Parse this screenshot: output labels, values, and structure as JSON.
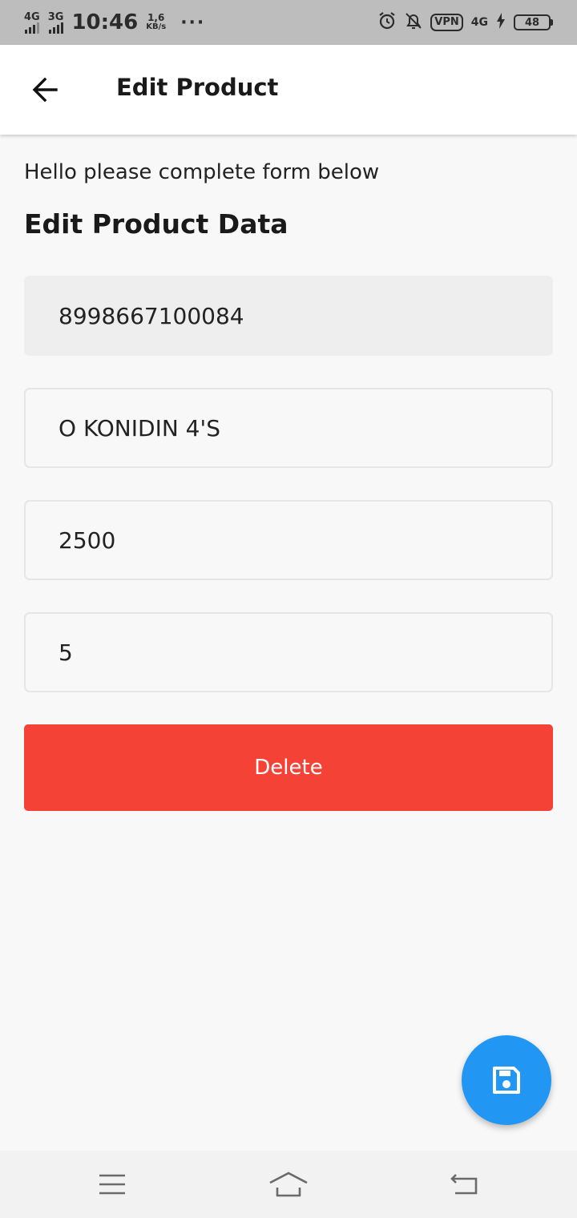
{
  "status_bar": {
    "net1": "4G",
    "net2": "3G",
    "time": "10:46",
    "speed_value": "1,6",
    "speed_unit": "KB/s",
    "more": "···",
    "vpn": "VPN",
    "net3": "4G",
    "battery": "48"
  },
  "app_bar": {
    "title": "Edit Product",
    "back_icon": "arrow-back-icon"
  },
  "form": {
    "intro": "Hello please complete form below",
    "title": "Edit Product Data",
    "barcode_value": "8998667100084",
    "name_value": "O KONIDIN 4'S",
    "price_value": "2500",
    "stock_value": "5",
    "delete_label": "Delete"
  },
  "fab": {
    "icon": "save-icon"
  },
  "nav": {
    "menu_icon": "menu-icon",
    "home_icon": "home-icon",
    "back_icon": "back-icon"
  },
  "colors": {
    "delete": "#f44336",
    "fab": "#2196f3",
    "status_bar": "#bdbdbd"
  }
}
